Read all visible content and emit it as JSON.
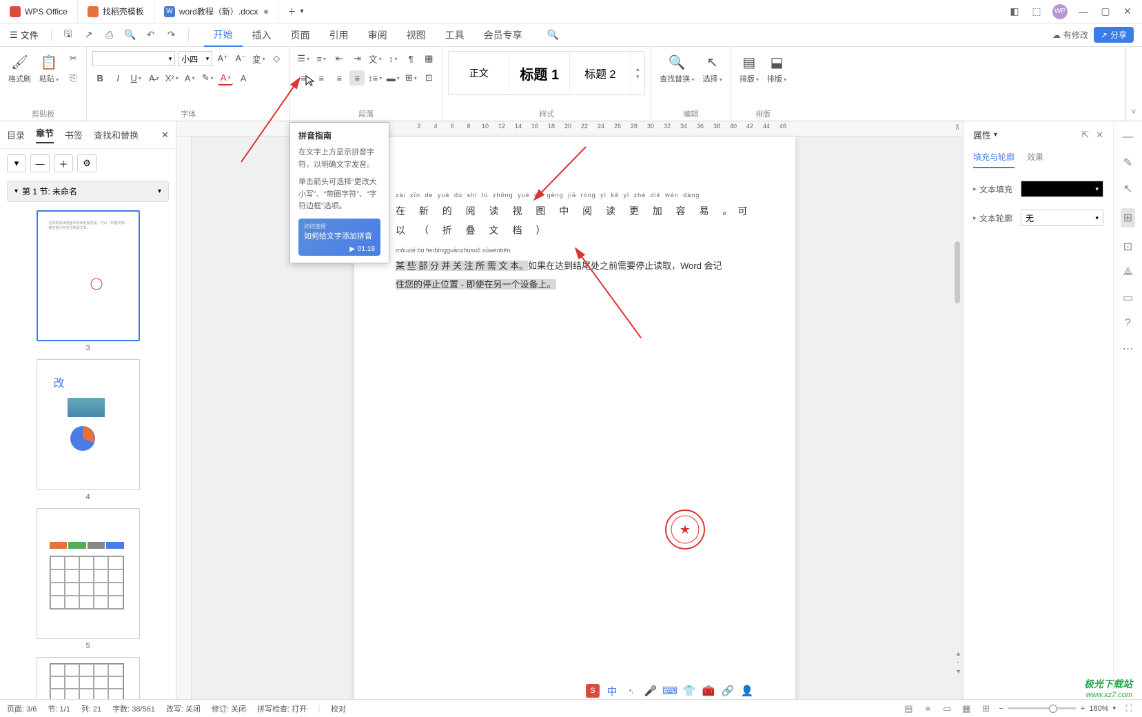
{
  "titlebar": {
    "tabs": [
      {
        "label": "WPS Office"
      },
      {
        "label": "找稻壳模板"
      },
      {
        "label": "word教程（新）.docx"
      }
    ],
    "new_tab_icon": "plus-icon",
    "avatar": "WP"
  },
  "menubar": {
    "file": "文件",
    "tabs": [
      "开始",
      "插入",
      "页面",
      "引用",
      "审阅",
      "视图",
      "工具",
      "会员专享"
    ],
    "active_tab": "开始",
    "modif": "有修改",
    "share": "分享"
  },
  "ribbon": {
    "clipboard": {
      "format_painter": "格式刷",
      "paste": "粘贴",
      "label": "剪贴板"
    },
    "font": {
      "font_name": "",
      "font_size": "小四",
      "label": "字体"
    },
    "paragraph": {
      "label": "段落"
    },
    "styles": {
      "items": [
        "正文",
        "标题 1",
        "标题 2"
      ],
      "label": "样式"
    },
    "editing": {
      "find_replace": "查找替换",
      "select": "选择",
      "label": "编辑"
    },
    "layout": {
      "arrange": "排版",
      "arrange2": "排版",
      "label": "排版"
    }
  },
  "tooltip": {
    "title": "拼音指南",
    "desc1": "在文字上方显示拼音字符，以明确文字发音。",
    "desc2": "单击箭头可选择“更改大小写”、“带圈字符”、“字符边框”选项。",
    "video_title": "如何给文字添加拼音",
    "video_time": "01:19"
  },
  "leftpanel": {
    "tabs": [
      "目录",
      "章节",
      "书签",
      "查找和替换"
    ],
    "active": "章节",
    "section": "第 1 节: 未命名",
    "thumbs": [
      3,
      4,
      5
    ]
  },
  "document": {
    "pinyin1": "zài xīn de yuè dú shì tú zhōng yuè dú gèng jiā róng yì  kě yǐ   zhé dié wén dàng",
    "line1": "在 新 的 阅 读 视 图 中 阅 读 更 加 容 易 。可 以 （ 折 叠 文 档 ）",
    "pinyin2": "mǒuxiē bù fenbìngguānzhùsuǒ xūwénběn",
    "body1a": "某 些 部 分 并 关 注 所 需 文 本。",
    "body1b": "如果在达到结尾处之前需要停止读取，Word 会记",
    "body2": "住您的停止位置 - 即使在另一个设备上。"
  },
  "rightpanel": {
    "title": "属性",
    "tabs": [
      "填充与轮廓",
      "效果"
    ],
    "active_tab": "填充与轮廓",
    "text_fill": "文本填充",
    "text_outline": "文本轮廓",
    "outline_value": "无"
  },
  "statusbar": {
    "page": "页面: 3/6",
    "section": "节: 1/1",
    "col": "列: 21",
    "words": "字数: 38/561",
    "track": "改写: 关闭",
    "revision": "修订: 关闭",
    "spell": "拼写检查: 打开",
    "proof": "校对",
    "zoom": "180%"
  },
  "tray": {
    "ime": "中"
  },
  "watermark": {
    "line1": "极光下载站",
    "line2": "www.xz7.com"
  },
  "ruler": [
    "2",
    "4",
    "6",
    "8",
    "10",
    "12",
    "14",
    "16",
    "18",
    "20",
    "22",
    "24",
    "26",
    "28",
    "30",
    "32",
    "34",
    "36",
    "38",
    "40",
    "42",
    "44",
    "46"
  ]
}
